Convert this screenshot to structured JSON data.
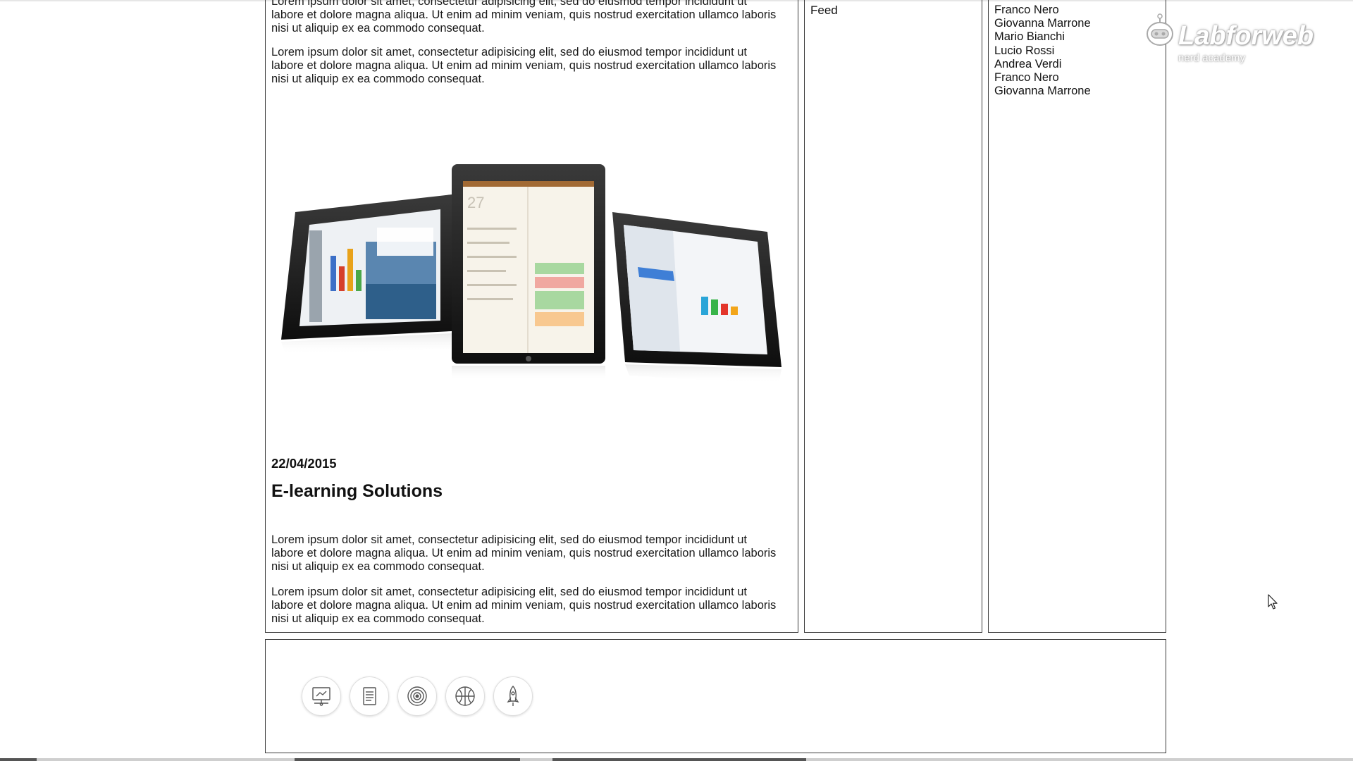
{
  "article": {
    "paragraphs": [
      "Lorem ipsum dolor sit amet, consectetur adipisicing elit, sed do eiusmod tempor incididunt ut labore et dolore magna aliqua. Ut enim ad minim veniam, quis nostrud exercitation ullamco laboris nisi ut aliquip ex ea commodo consequat.",
      "Lorem ipsum dolor sit amet, consectetur adipisicing elit, sed do eiusmod tempor incididunt ut labore et dolore magna aliqua. Ut enim ad minim veniam, quis nostrud exercitation ullamco laboris nisi ut aliquip ex ea commodo consequat.",
      "Lorem ipsum dolor sit amet, consectetur adipisicing elit, sed do eiusmod tempor incididunt ut labore et dolore magna aliqua. Ut enim ad minim veniam, quis nostrud exercitation ullamco laboris nisi ut aliquip ex ea commodo consequat.",
      "Lorem ipsum dolor sit amet, consectetur adipisicing elit, sed do eiusmod tempor incididunt ut labore et dolore magna aliqua. Ut enim ad minim veniam, quis nostrud exercitation ullamco laboris nisi ut aliquip ex ea commodo consequat."
    ],
    "date": "22/04/2015",
    "title": "E-learning Solutions",
    "image_icon": "tablets-image",
    "tablet_day_number": "27"
  },
  "feed": {
    "label": "Feed"
  },
  "names": [
    "Franco Nero",
    "Giovanna Marrone",
    "Mario Bianchi",
    "Lucio Rossi",
    "Andrea Verdi",
    "Franco Nero",
    "Giovanna Marrone"
  ],
  "footer": {
    "icons": [
      "presentation-icon",
      "document-icon",
      "target-icon",
      "basketball-icon",
      "rocket-icon"
    ]
  },
  "brand": {
    "name": "Labforweb",
    "tagline": "nerd academy"
  },
  "colors": {
    "border": "#3a3a3a",
    "text": "#1a1a1a",
    "icon_stroke": "#555555"
  }
}
